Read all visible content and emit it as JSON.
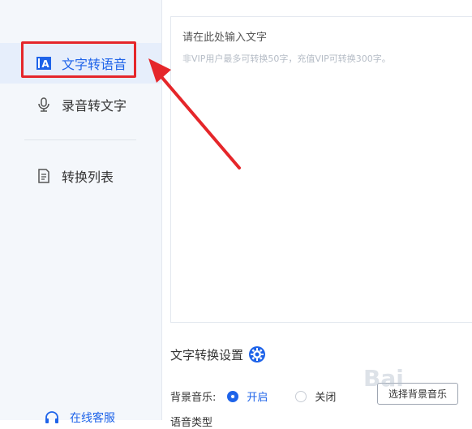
{
  "sidebar": {
    "items": [
      {
        "label": "文字转语音",
        "icon": "text-to-speech-icon",
        "active": true
      },
      {
        "label": "录音转文字",
        "icon": "microphone-icon",
        "active": false
      },
      {
        "label": "转换列表",
        "icon": "document-list-icon",
        "active": false
      }
    ],
    "service": {
      "label": "在线客服",
      "icon": "headset-icon"
    }
  },
  "editor": {
    "placeholder": "请在此处输入文字",
    "hint": "非VIP用户最多可转换50字，充值VIP可转换300字。"
  },
  "settings": {
    "title": "文字转换设置",
    "icon": "gear-icon",
    "background_music": {
      "label": "背景音乐:",
      "options": [
        {
          "label": "开启",
          "selected": true
        },
        {
          "label": "关闭",
          "selected": false
        }
      ],
      "button_label": "选择背景音乐"
    },
    "next_row_label": "语音类型"
  },
  "colors": {
    "accent": "#1e63e9",
    "highlight": "#e5262a",
    "sidebar_bg": "#f4f7fb"
  },
  "watermark": "Bai"
}
